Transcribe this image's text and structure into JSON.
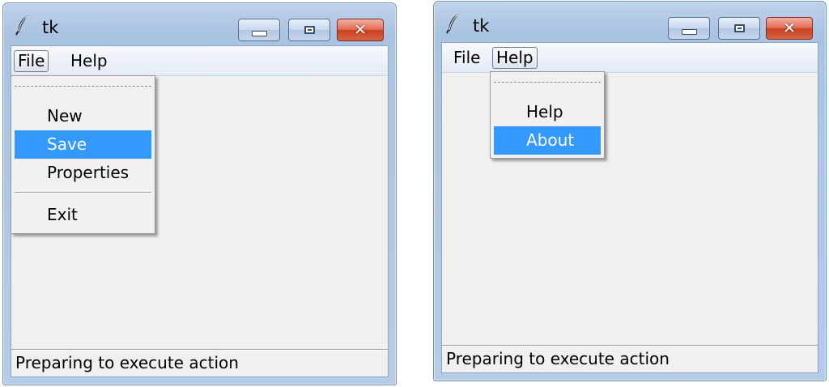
{
  "left_window": {
    "title": "tk",
    "menubar": {
      "file": "File",
      "help": "Help"
    },
    "open_menu": "File",
    "file_menu": {
      "tearoff": "- - - - - - - -",
      "items": [
        "New",
        "Save",
        "Properties",
        "Exit"
      ],
      "highlighted": "Save"
    },
    "status": "Preparing to execute action"
  },
  "right_window": {
    "title": "tk",
    "menubar": {
      "file": "File",
      "help": "Help"
    },
    "open_menu": "Help",
    "help_menu": {
      "tearoff": "- - - - - -",
      "items": [
        "Help",
        "About"
      ],
      "highlighted": "About"
    },
    "status": "Preparing to execute action"
  },
  "colors": {
    "menu_highlight": "#3399ff",
    "close_button": "#d6654a",
    "title_bar": "#b5cce8"
  },
  "icons": {
    "app": "tk-feather-icon",
    "minimize": "minimize-icon",
    "maximize": "maximize-icon",
    "close": "close-icon"
  }
}
